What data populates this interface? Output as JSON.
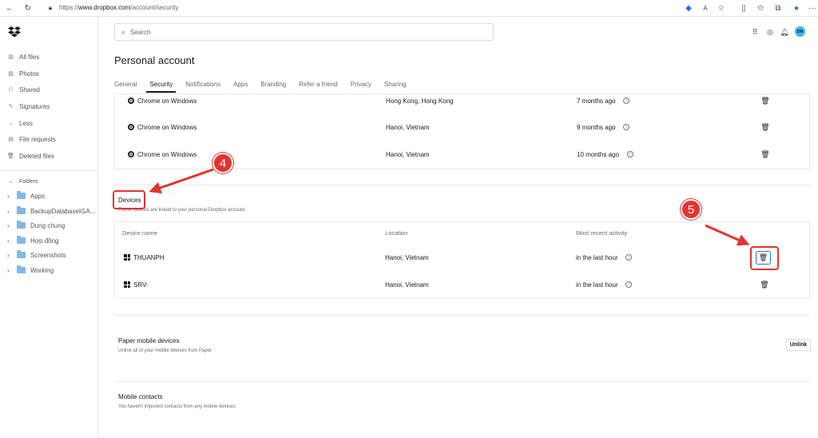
{
  "browser": {
    "url_prefix": "https://",
    "url_host": "www.dropbox.com",
    "url_path": "/account/security",
    "more_label": "···"
  },
  "sidebar": {
    "items": [
      {
        "label": "All files",
        "icon": "all-files-icon"
      },
      {
        "label": "Photos",
        "icon": "photos-icon"
      },
      {
        "label": "Shared",
        "icon": "shared-icon"
      },
      {
        "label": "Signatures",
        "icon": "signatures-icon"
      },
      {
        "label": "Less",
        "icon": "chevron-down-icon"
      },
      {
        "label": "File requests",
        "icon": "file-requests-icon"
      },
      {
        "label": "Deleted files",
        "icon": "trash-icon"
      }
    ],
    "folders_label": "Folders",
    "folders": [
      "Apps",
      "BackupDatabaseIGA...",
      "Dung chung",
      "Hợp đồng",
      "Screenshots",
      "Working"
    ]
  },
  "header": {
    "search_placeholder": "Search",
    "avatar_initials": "DN"
  },
  "page": {
    "title": "Personal account",
    "tabs": [
      "General",
      "Security",
      "Notifications",
      "Apps",
      "Branding",
      "Refer a friend",
      "Privacy",
      "Sharing"
    ],
    "active_tab": "Security"
  },
  "sessions": [
    {
      "name": "Chrome on Windows",
      "location": "Hong Kong, Hong Kong",
      "activity": "7 months ago"
    },
    {
      "name": "Chrome on Windows",
      "location": "Hanoi, Vietnam",
      "activity": "9 months ago"
    },
    {
      "name": "Chrome on Windows",
      "location": "Hanoi, Vietnam",
      "activity": "10 months ago"
    }
  ],
  "devices": {
    "title": "Devices",
    "description": "These devices are linked to your personal Dropbox account.",
    "columns": [
      "Device name",
      "Location",
      "Most recent activity"
    ],
    "rows": [
      {
        "name": "THUANPH",
        "location": "Hanoi, Vietnam",
        "activity": "in the last hour"
      },
      {
        "name": "SRV-",
        "location": "Hanoi, Vietnam",
        "activity": "in the last hour"
      }
    ]
  },
  "paper": {
    "title": "Paper mobile devices",
    "description": "Unlink all of your mobile devices from Paper.",
    "button": "Unlink"
  },
  "contacts": {
    "title": "Mobile contacts",
    "description": "You haven't imported contacts from any mobile devices."
  },
  "annotations": {
    "step_a": "4",
    "step_b": "5",
    "color": "#e3342f"
  }
}
